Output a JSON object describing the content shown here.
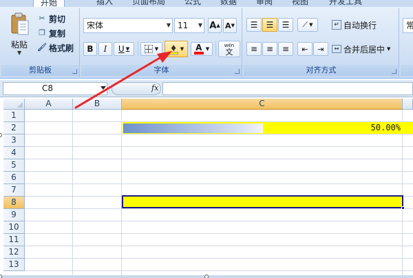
{
  "tabs": [
    {
      "label": "开始",
      "active": true
    },
    {
      "label": "插入"
    },
    {
      "label": "页面布局"
    },
    {
      "label": "公式"
    },
    {
      "label": "数据"
    },
    {
      "label": "审阅"
    },
    {
      "label": "视图"
    },
    {
      "label": "开发工具"
    }
  ],
  "clipboard": {
    "paste_label": "粘贴",
    "cut_label": "剪切",
    "copy_label": "复制",
    "format_painter_label": "格式刷",
    "group_label": "剪贴板"
  },
  "font": {
    "font_name": "宋体",
    "font_size": "11",
    "bold": "B",
    "italic": "I",
    "underline": "U",
    "grow_font": "A",
    "shrink_font": "A",
    "font_color_letter": "A",
    "phonetic": "wén",
    "phonetic_char": "文",
    "group_label": "字体",
    "fill_color": "#ffff00",
    "font_color": "#ff0000"
  },
  "alignment": {
    "wrap_text_label": "自动换行",
    "merge_center_label": "合并后居中",
    "group_label": "对齐方式"
  },
  "number": {
    "format_label": "常"
  },
  "formula_bar": {
    "name_box": "C8",
    "fx_label": "fx",
    "formula": ""
  },
  "sheet": {
    "columns": [
      "A",
      "B",
      "C"
    ],
    "rows": [
      "1",
      "2",
      "3",
      "4",
      "5",
      "6",
      "7",
      "8",
      "9",
      "10",
      "11",
      "12",
      "13"
    ],
    "selected_column": "C",
    "selected_row": "8",
    "active_cell": "C8",
    "c2_display": "50.00%",
    "c2_value": 0.5,
    "highlight_color": "#ffff00"
  },
  "icons": {
    "paste": "paste-icon",
    "cut": "scissors-icon",
    "copy": "copy-icon",
    "format_painter": "brush-icon",
    "borders": "borders-icon",
    "fill_color": "fill-color-bucket-icon",
    "annotation": "red-arrow-pointing-to-fill-color"
  }
}
